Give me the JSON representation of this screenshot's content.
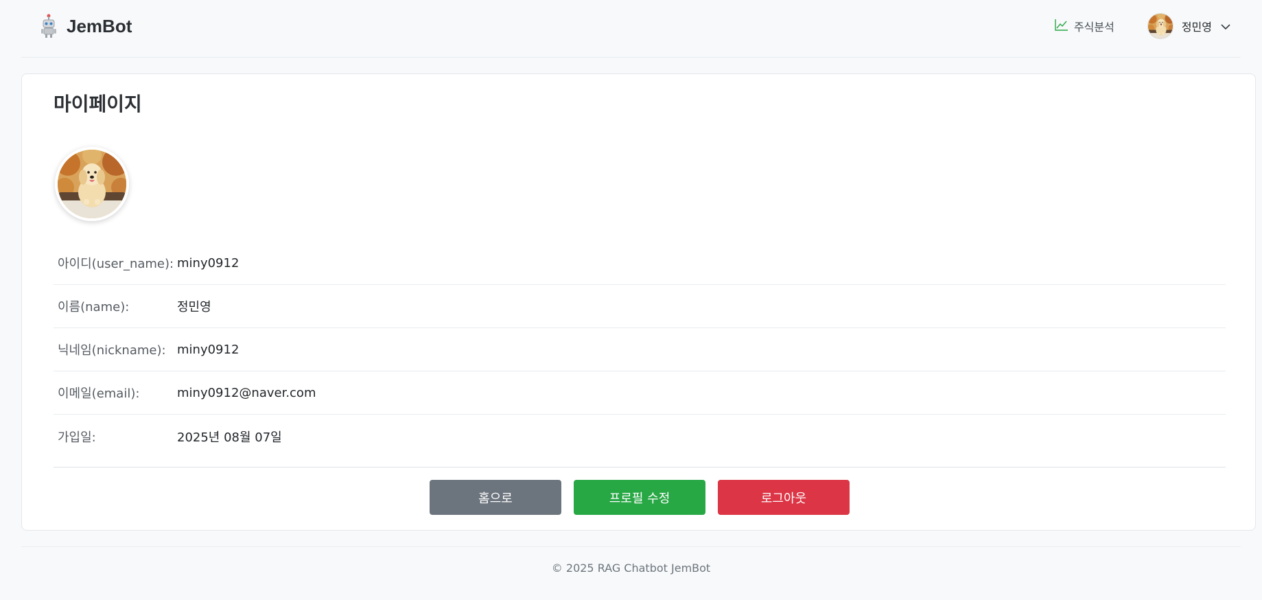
{
  "header": {
    "brand_name": "JemBot",
    "nav_stock_label": "주식분석",
    "user_name": "정민영"
  },
  "profile": {
    "title": "마이페이지",
    "rows": [
      {
        "label": "아이디(user_name):",
        "value": "miny0912"
      },
      {
        "label": "이름(name):",
        "value": "정민영"
      },
      {
        "label": "닉네임(nickname):",
        "value": "miny0912"
      },
      {
        "label": "이메일(email):",
        "value": "miny0912@naver.com"
      },
      {
        "label": "가입일:",
        "value": "2025년 08월 07일"
      }
    ]
  },
  "buttons": {
    "home_label": "홈으로",
    "edit_label": "프로필 수정",
    "logout_label": "로그아웃"
  },
  "footer": {
    "text": "© 2025 RAG Chatbot JemBot"
  },
  "colors": {
    "home": "#6c757d",
    "edit": "#28a745",
    "logout": "#dc3545",
    "chart_icon": "#28a745"
  },
  "icons": {
    "logo": "robot-icon",
    "stock": "line-chart-icon",
    "dropdown": "chevron-down-icon"
  }
}
